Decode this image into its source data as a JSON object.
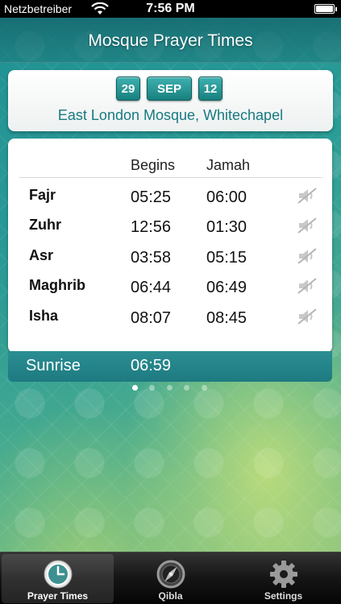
{
  "status_bar": {
    "carrier": "Netzbetreiber",
    "time": "7:56 PM"
  },
  "nav": {
    "title": "Mosque Prayer Times"
  },
  "date": {
    "day": "29",
    "month": "SEP",
    "year": "12"
  },
  "location": "East London Mosque, Whitechapel",
  "table": {
    "headers": {
      "begins": "Begins",
      "jamah": "Jamah"
    },
    "rows": [
      {
        "name": "Fajr",
        "begins": "05:25",
        "jamah": "06:00"
      },
      {
        "name": "Zuhr",
        "begins": "12:56",
        "jamah": "01:30"
      },
      {
        "name": "Asr",
        "begins": "03:58",
        "jamah": "05:15"
      },
      {
        "name": "Maghrib",
        "begins": "06:44",
        "jamah": "06:49"
      },
      {
        "name": "Isha",
        "begins": "08:07",
        "jamah": "08:45"
      }
    ]
  },
  "sunrise": {
    "label": "Sunrise",
    "time": "06:59"
  },
  "tabs": [
    {
      "label": "Prayer Times",
      "icon": "clock-icon",
      "active": true
    },
    {
      "label": "Qibla",
      "icon": "compass-icon",
      "active": false
    },
    {
      "label": "Settings",
      "icon": "gear-icon",
      "active": false
    }
  ],
  "colors": {
    "accent": "#177a80",
    "date_box": "#2a9898"
  }
}
